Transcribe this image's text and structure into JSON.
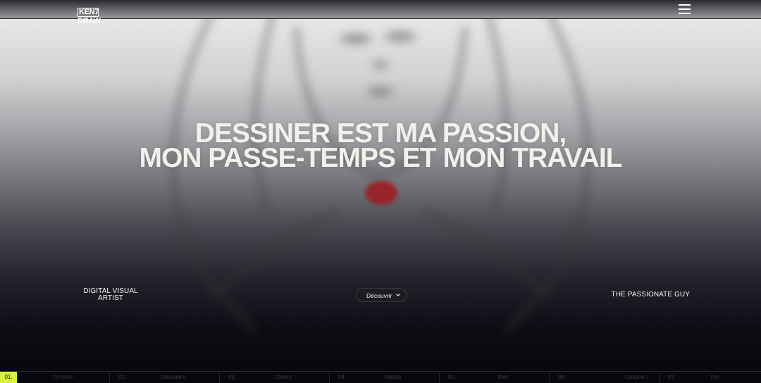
{
  "header": {
    "logo_line1": "KEN7",
    "logo_line2": "DRAW",
    "menu_icon": "hamburger-menu-icon"
  },
  "hero": {
    "headline_line1": "DESSINER EST MA PASSION,",
    "headline_line2": "MON PASSE-TEMPS ET MON TRAVAIL",
    "tagline_left": "DIGITAL VISUAL ARTIST",
    "tagline_right": "THE PASSIONATE GUY",
    "discover_label": "Découvrir",
    "discover_icon": "chevron-down-icon",
    "accent_color": "#9e1d24"
  },
  "bottom_nav": {
    "active_color": "#d7f039",
    "items": [
      {
        "num": "01.",
        "label": "I'm Ken"
      },
      {
        "num": "02.",
        "label": "Découvre"
      },
      {
        "num": "03.",
        "label": "Clients"
      },
      {
        "num": "04.",
        "label": "Inédits"
      },
      {
        "num": "05.",
        "label": "Moi"
      },
      {
        "num": "06.",
        "label": "Coucou !"
      },
      {
        "num": "07.",
        "label": "Fin"
      }
    ]
  }
}
